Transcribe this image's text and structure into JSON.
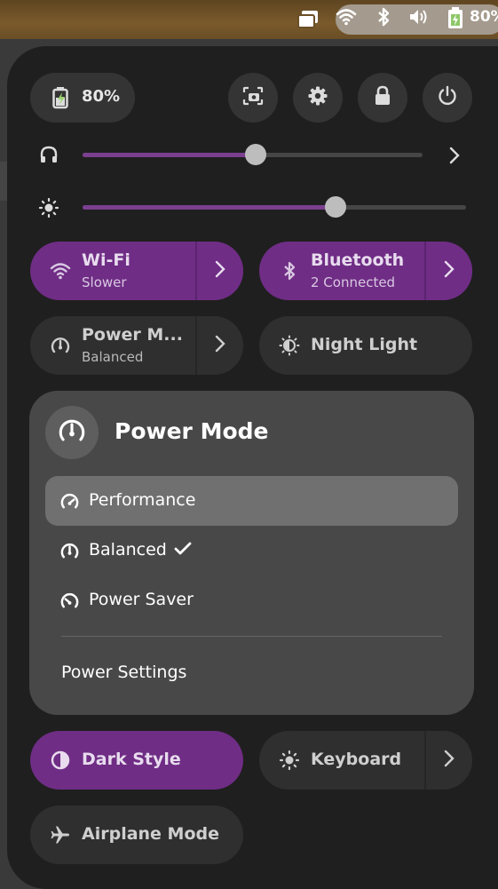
{
  "top_bar": {
    "battery_percent": "80%",
    "icons": [
      "windows-icon",
      "wifi-icon",
      "bluetooth-icon",
      "volume-icon",
      "battery-icon"
    ]
  },
  "quick_settings": {
    "battery_label": "80%",
    "header_buttons": [
      "screenshot-icon",
      "settings-icon",
      "lock-icon",
      "power-icon"
    ],
    "volume_level": 0.51,
    "brightness_level": 0.66,
    "tiles": {
      "wifi": {
        "title": "Wi-Fi",
        "subtitle": "Slower",
        "active": true
      },
      "bluetooth": {
        "title": "Bluetooth",
        "subtitle": "2 Connected",
        "active": true
      },
      "power_mode": {
        "title": "Power M...",
        "subtitle": "Balanced",
        "active": false
      },
      "night_light": {
        "title": "Night Light",
        "active": false
      },
      "dark_style": {
        "title": "Dark Style",
        "active": true
      },
      "keyboard": {
        "title": "Keyboard",
        "active": false
      },
      "airplane": {
        "title": "Airplane Mode",
        "active": false
      }
    }
  },
  "power_menu": {
    "title": "Power Mode",
    "items": [
      {
        "label": "Performance",
        "selected": false
      },
      {
        "label": "Balanced",
        "selected": true
      },
      {
        "label": "Power Saver",
        "selected": false
      }
    ],
    "settings_label": "Power Settings"
  },
  "colors": {
    "accent": "#6f2d85",
    "panel": "#1f1f1f",
    "menu": "#484848"
  }
}
